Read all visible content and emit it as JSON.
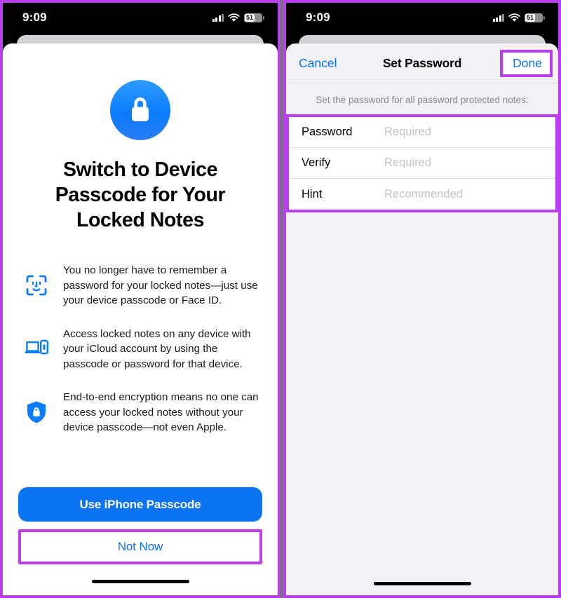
{
  "status_bar": {
    "time": "9:09",
    "cellular_icon": "cellular-bars-icon",
    "wifi_icon": "wifi-icon",
    "battery_percent": "51",
    "battery_icon": "battery-icon"
  },
  "colors": {
    "accent_blue": "#0a74f2",
    "highlight_purple": "#bb3ef0",
    "icon_blue": "#0a7cff",
    "sheet_gray": "#f2f1f6",
    "placeholder_gray": "#c3c2c7"
  },
  "left_screen": {
    "lock_icon": "padlock-icon",
    "title": "Switch to Device Passcode for Your Locked Notes",
    "features": [
      {
        "icon": "face-id-icon",
        "text": "You no longer have to remember a password for your locked notes—just use your device passcode or Face ID."
      },
      {
        "icon": "laptop-and-phone-icon",
        "text": "Access locked notes on any device with your iCloud account by using the passcode or password for that device."
      },
      {
        "icon": "shield-lock-icon",
        "text": "End-to-end encryption means no one can access your locked notes without your device passcode—not even Apple."
      }
    ],
    "primary_button": "Use iPhone Passcode",
    "secondary_button": "Not Now",
    "home_indicator": "home-indicator"
  },
  "right_screen": {
    "nav": {
      "cancel": "Cancel",
      "title": "Set Password",
      "done": "Done"
    },
    "caption": "Set the password for all password protected notes:",
    "fields": [
      {
        "label": "Password",
        "value": "",
        "placeholder": "Required"
      },
      {
        "label": "Verify",
        "value": "",
        "placeholder": "Required"
      },
      {
        "label": "Hint",
        "value": "",
        "placeholder": "Recommended"
      }
    ],
    "home_indicator": "home-indicator"
  }
}
